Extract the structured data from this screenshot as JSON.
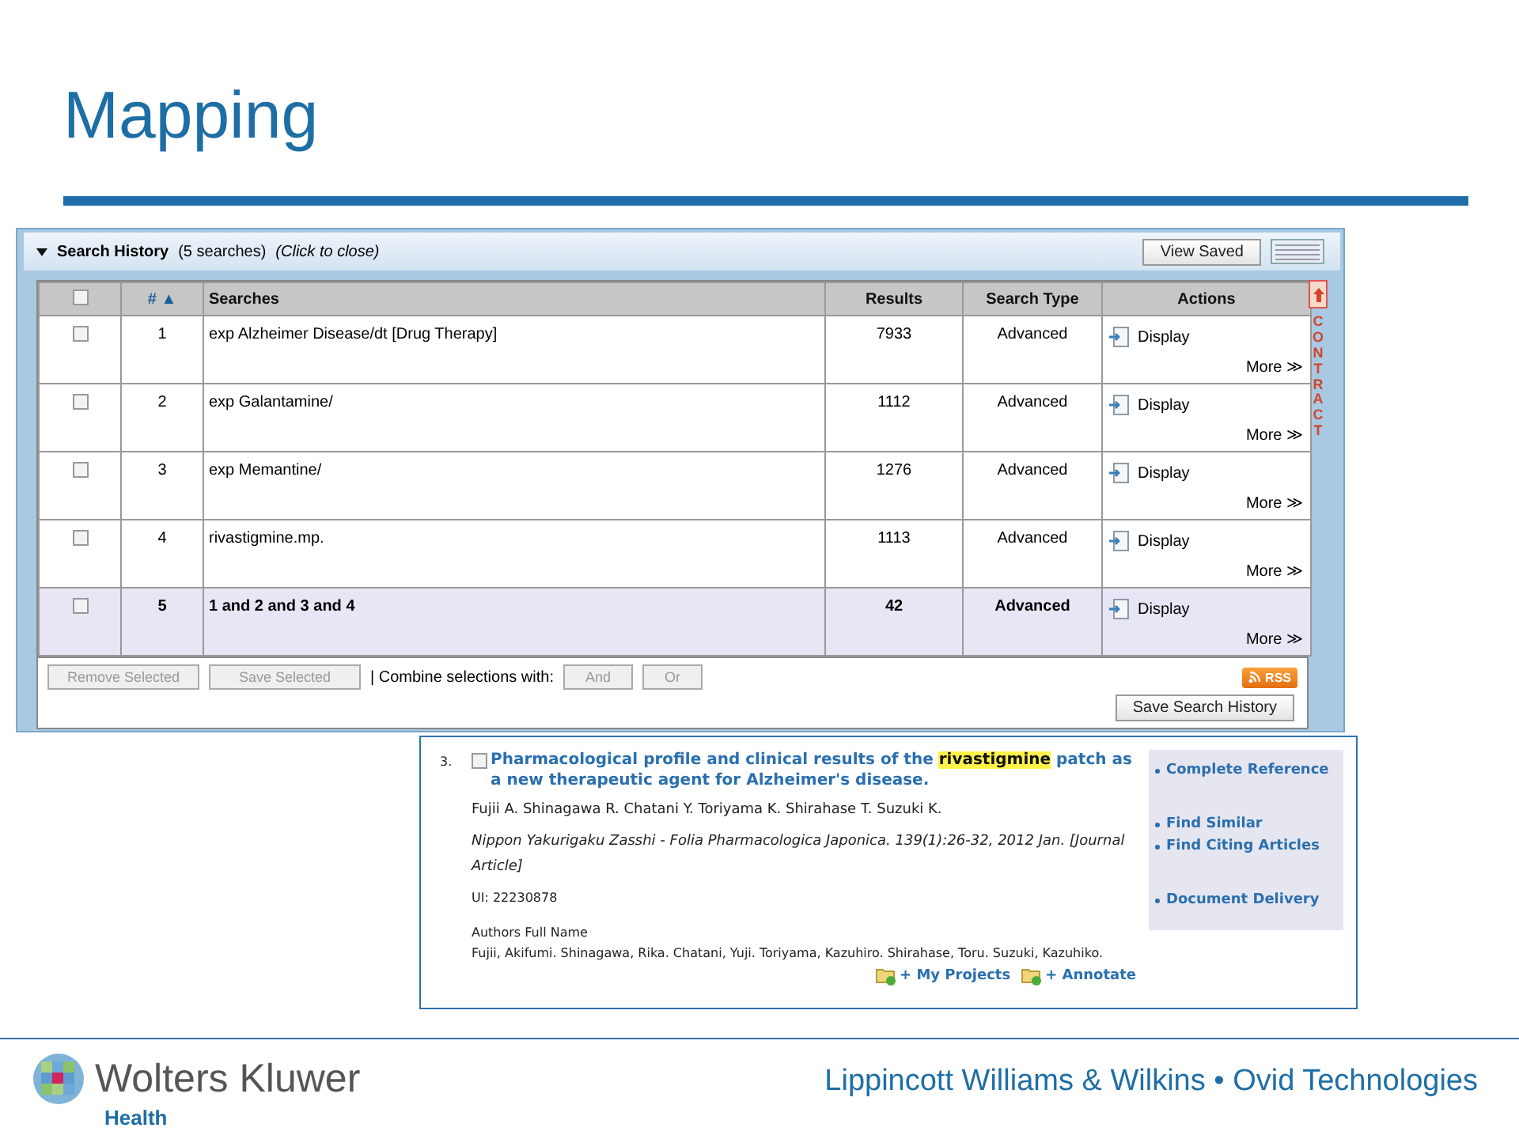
{
  "slide_title": "Mapping",
  "search_history": {
    "title": "Search History",
    "count": "(5 searches)",
    "hint": "(Click to close)",
    "view_saved": "View Saved",
    "columns": [
      {
        "kind": "checkbox",
        "checked": false
      },
      {
        "kind": "number",
        "label": "#",
        "sort": "▲"
      },
      {
        "kind": "text",
        "label": "Searches"
      },
      {
        "kind": "text",
        "label": "Results"
      },
      {
        "kind": "text",
        "label": "Search Type"
      },
      {
        "kind": "text",
        "label": "Actions"
      }
    ],
    "rows": [
      {
        "number": "1",
        "search": "exp Alzheimer Disease/dt [Drug Therapy]",
        "results": "7933",
        "type": "Advanced",
        "display": "Display",
        "more": "More ≫",
        "checked": false,
        "highlighted": false
      },
      {
        "number": "2",
        "search": "exp Galantamine/",
        "results": "1112",
        "type": "Advanced",
        "display": "Display",
        "more": "More ≫",
        "checked": false,
        "highlighted": false
      },
      {
        "number": "3",
        "search": "exp Memantine/",
        "results": "1276",
        "type": "Advanced",
        "display": "Display",
        "more": "More ≫",
        "checked": false,
        "highlighted": false
      },
      {
        "number": "4",
        "search": "rivastigmine.mp.",
        "results": "1113",
        "type": "Advanced",
        "display": "Display",
        "more": "More ≫",
        "checked": false,
        "highlighted": false
      },
      {
        "number": "5",
        "search": "1 and 2 and 3 and 4",
        "results": "42",
        "type": "Advanced",
        "display": "Display",
        "more": "More ≫",
        "checked": false,
        "highlighted": true
      }
    ],
    "side_tab": "CONTRACT",
    "buttons": [
      {
        "label": "Remove Selected",
        "disabled": true
      },
      {
        "label": "Save Selected",
        "disabled": true
      }
    ],
    "combine_label": "| Combine selections with:",
    "combine_buttons": [
      {
        "label": "And",
        "disabled": true
      },
      {
        "label": "Or",
        "disabled": true
      }
    ],
    "rss": "RSS",
    "save_history": "Save Search History"
  },
  "citation": {
    "number": "3.",
    "checked": false,
    "title": [
      {
        "text": "Pharmacological profile and clinical results of the ",
        "highlighted": false
      },
      {
        "text": "rivastigmine",
        "highlighted": true
      },
      {
        "text": " patch as a new therapeutic agent for Alzheimer's disease.",
        "highlighted": false
      }
    ],
    "authors": "Fujii A. Shinagawa R. Chatani Y. Toriyama K. Shirahase T. Suzuki K.",
    "source": "Nippon Yakurigaku Zasshi - Folia Pharmacologica Japonica. 139(1):26-32, 2012 Jan. [Journal Article]",
    "ui": "UI: 22230878",
    "authors_heading": "Authors Full Name",
    "authors_full": "Fujii, Akifumi. Shinagawa, Rika. Chatani, Yuji. Toriyama, Kazuhiro. Shirahase, Toru. Suzuki, Kazuhiko.",
    "actions": [
      "+ My Projects",
      "+ Annotate"
    ],
    "link_groups": [
      [
        "Complete Reference"
      ],
      [
        "Find Similar",
        "Find Citing Articles"
      ],
      [
        "Document Delivery"
      ]
    ]
  },
  "footer": {
    "brand": "Wolters Kluwer",
    "division": "Health",
    "tagline": "Lippincott Williams & Wilkins • Ovid Technologies"
  }
}
